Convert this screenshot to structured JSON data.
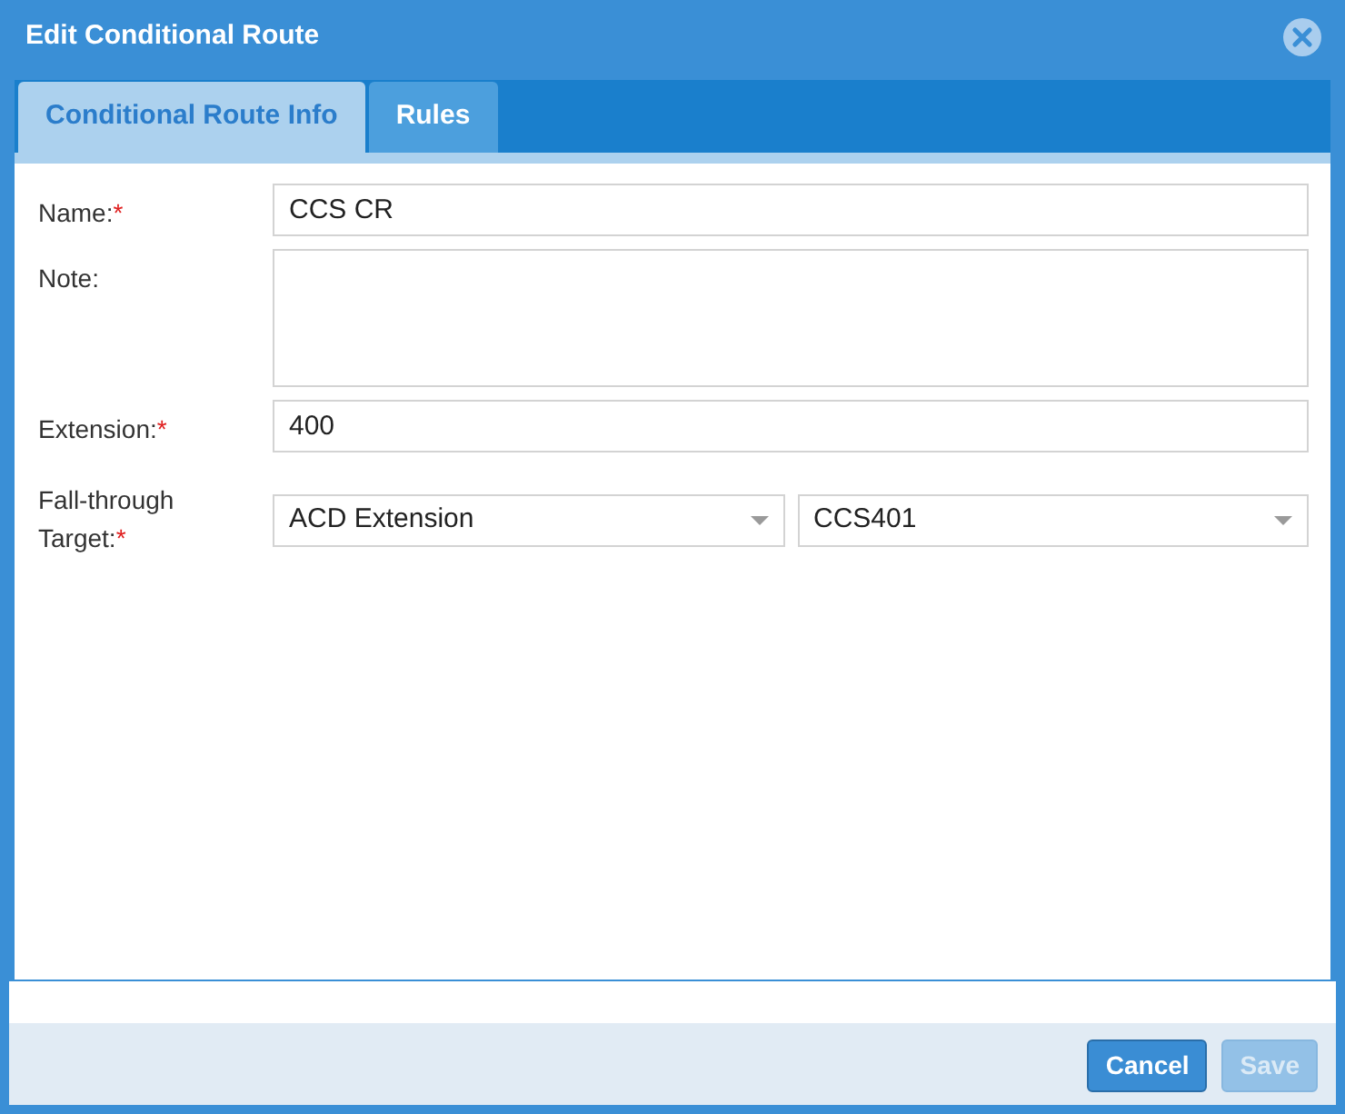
{
  "window": {
    "title": "Edit Conditional Route"
  },
  "tabs": [
    {
      "label": "Conditional Route Info",
      "selected": true
    },
    {
      "label": "Rules",
      "selected": false
    }
  ],
  "form": {
    "fields": [
      {
        "kind": "text",
        "label": "Name:",
        "required_mark": "*",
        "value": "CCS CR"
      },
      {
        "kind": "textarea",
        "label": "Note:"
      },
      {
        "kind": "text",
        "label": "Extension:",
        "required_mark": "*",
        "value": "400"
      },
      {
        "kind": "selects",
        "label": "Fall-through Target:",
        "required_mark": "*",
        "values": [
          "ACD Extension",
          "CCS401"
        ]
      }
    ]
  },
  "buttons": [
    {
      "label": "Cancel",
      "disabled": false
    },
    {
      "label": "Save",
      "disabled": true
    }
  ]
}
